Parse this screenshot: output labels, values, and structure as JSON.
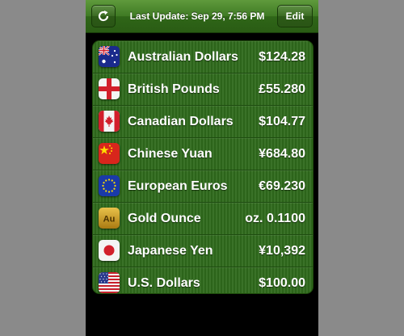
{
  "toolbar": {
    "refresh_icon": "refresh-icon",
    "title": "Last Update: Sep 29, 7:56 PM",
    "edit_label": "Edit"
  },
  "currencies": [
    {
      "name": "Australian Dollars",
      "amount": "$124.28",
      "flag": "australia-flag-icon"
    },
    {
      "name": "British Pounds",
      "amount": "£55.280",
      "flag": "england-flag-icon"
    },
    {
      "name": "Canadian Dollars",
      "amount": "$104.77",
      "flag": "canada-flag-icon"
    },
    {
      "name": "Chinese Yuan",
      "amount": "¥684.80",
      "flag": "china-flag-icon"
    },
    {
      "name": "European Euros",
      "amount": "€69.230",
      "flag": "eu-flag-icon"
    },
    {
      "name": "Gold Ounce",
      "amount": "oz. 0.1100",
      "flag": "gold-icon",
      "icon_text": "Au"
    },
    {
      "name": "Japanese Yen",
      "amount": "¥10,392",
      "flag": "japan-flag-icon"
    },
    {
      "name": "U.S. Dollars",
      "amount": "$100.00",
      "flag": "usa-flag-icon"
    }
  ],
  "colors": {
    "toolbar_green": "#3f7a24",
    "list_green": "#2f6a1c",
    "side_gray": "#8a8a8a"
  }
}
